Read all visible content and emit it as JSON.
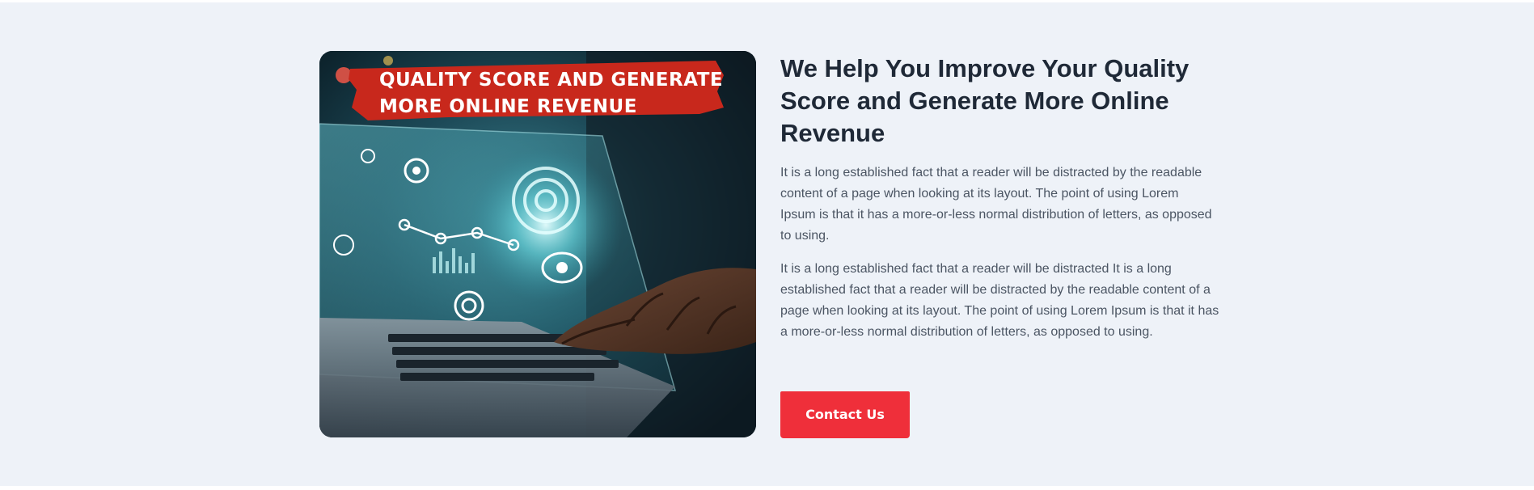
{
  "hero": {
    "banner_text": "QUALITY SCORE AND GENERATE MORE ONLINE REVENUE",
    "banner_color": "#c8281c"
  },
  "content": {
    "heading": "We Help You Improve Your Quality Score and Generate More Online Revenue",
    "paragraph_1": "It is a long established fact that a reader will be distracted by the readable content of a page when looking at its layout. The point of using Lorem Ipsum is that it has a more-or-less normal distribution of letters, as opposed to using.",
    "paragraph_2": "It is a long established fact that a reader will be distracted It is a long established fact that a reader will be distracted by the readable content of a page when looking at its layout. The point of using Lorem Ipsum is that it has a more-or-less normal distribution of letters, as opposed to using.",
    "button_label": "Contact Us"
  },
  "colors": {
    "page_background": "#eef2f8",
    "heading": "#1f2937",
    "body_text": "#4b5563",
    "accent": "#ef2f3a"
  }
}
